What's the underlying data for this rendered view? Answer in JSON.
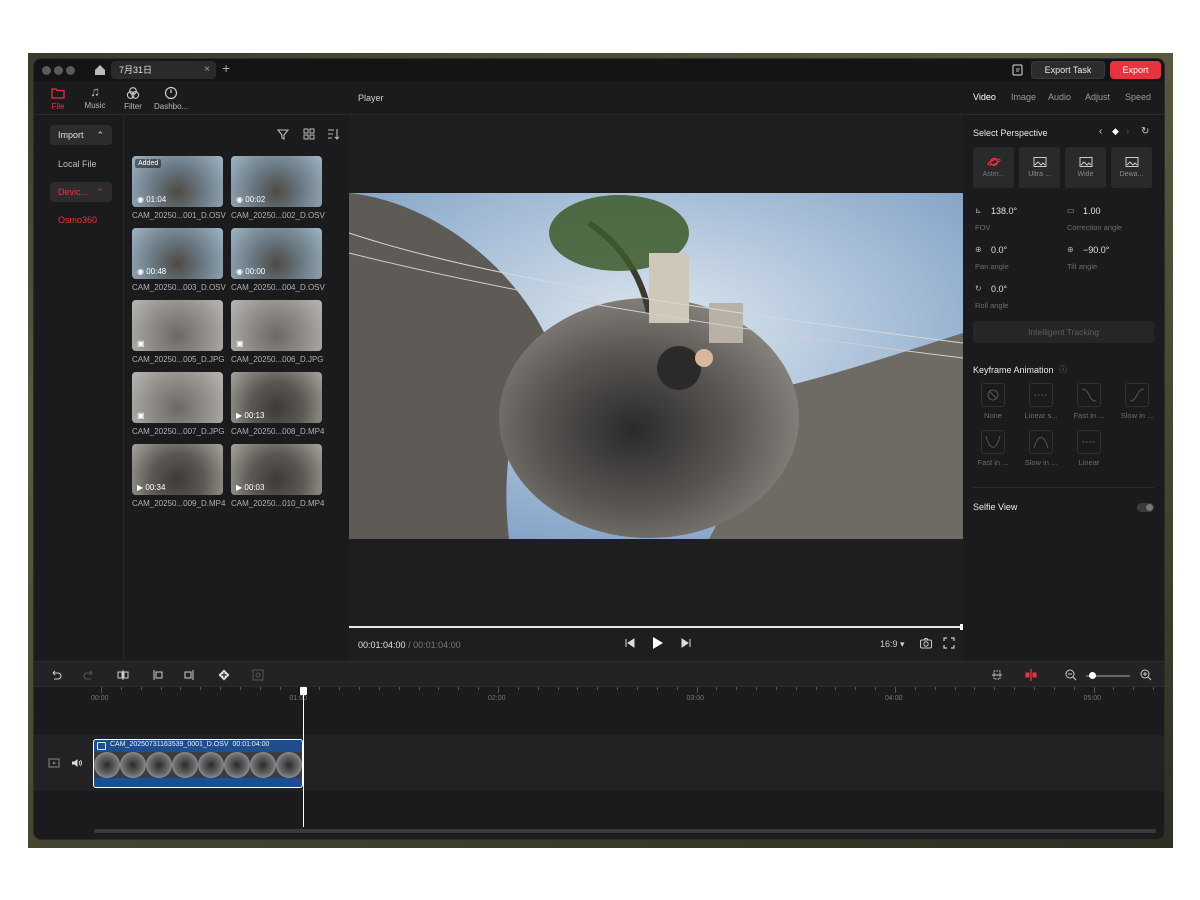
{
  "window": {
    "tab_title": "7月31日",
    "export_task_label": "Export Task",
    "export_label": "Export"
  },
  "topnav": [
    {
      "label": "File",
      "icon": "folder-icon",
      "active": true
    },
    {
      "label": "Music",
      "icon": "music-note-icon",
      "active": false
    },
    {
      "label": "Filter",
      "icon": "filter-circles-icon",
      "active": false
    },
    {
      "label": "Dashbo...",
      "icon": "gauge-icon",
      "active": false
    }
  ],
  "sidebar": {
    "import_label": "Import",
    "local_file_label": "Local File",
    "device_label": "Devic...",
    "osmo_label": "Osmo360"
  },
  "media": [
    {
      "name": "CAM_20250...001_D.OSV",
      "duration": "01:04",
      "badge": "Added",
      "kind": "osv"
    },
    {
      "name": "CAM_20250...002_D.OSV",
      "duration": "00:02",
      "badge": "",
      "kind": "osv"
    },
    {
      "name": "CAM_20250...003_D.OSV",
      "duration": "00:48",
      "badge": "",
      "kind": "osv"
    },
    {
      "name": "CAM_20250...004_D.OSV",
      "duration": "00:00",
      "badge": "",
      "kind": "osv"
    },
    {
      "name": "CAM_20250...005_D.JPG",
      "duration": "",
      "badge": "",
      "kind": "jpg"
    },
    {
      "name": "CAM_20250...006_D.JPG",
      "duration": "",
      "badge": "",
      "kind": "jpg"
    },
    {
      "name": "CAM_20250...007_D.JPG",
      "duration": "",
      "badge": "",
      "kind": "jpg"
    },
    {
      "name": "CAM_20250...008_D.MP4",
      "duration": "00:13",
      "badge": "",
      "kind": "mp4"
    },
    {
      "name": "CAM_20250...009_D.MP4",
      "duration": "00:34",
      "badge": "",
      "kind": "mp4"
    },
    {
      "name": "CAM_20250...010_D.MP4",
      "duration": "00:03",
      "badge": "",
      "kind": "mp4"
    }
  ],
  "player": {
    "title": "Player",
    "current_time": "00:01:04:00",
    "total_time": "/ 00:01:04:00",
    "aspect_ratio": "16:9 ▾"
  },
  "right_tabs": [
    {
      "label": "Video",
      "active": true
    },
    {
      "label": "Image",
      "active": false
    },
    {
      "label": "Audio",
      "active": false
    },
    {
      "label": "Adjust",
      "active": false
    },
    {
      "label": "Speed",
      "active": false
    }
  ],
  "perspective": {
    "title": "Select Perspective",
    "options": [
      {
        "label": "Aster...",
        "icon": "planet-icon",
        "active": true
      },
      {
        "label": "Ultra ...",
        "icon": "image-icon",
        "active": false
      },
      {
        "label": "Wide",
        "icon": "image-icon",
        "active": false
      },
      {
        "label": "Dewa...",
        "icon": "image-icon",
        "active": false
      }
    ]
  },
  "params": {
    "fov_value": "138.0°",
    "fov_label": "FOV",
    "correction_value": "1.00",
    "correction_label": "Correction angle",
    "pan_value": "0.0°",
    "pan_label": "Pan angle",
    "tilt_value": "−90.0°",
    "tilt_label": "Tilt angle",
    "roll_value": "0.0°",
    "roll_label": "Roll angle"
  },
  "tracking_label": "Intelligent Tracking",
  "keyframe": {
    "title": "Keyframe Animation",
    "options": [
      "None",
      "Linear s...",
      "Fast in ...",
      "Slow in ...",
      "Fast in ...",
      "Slow in ...",
      "Linear"
    ]
  },
  "selfie_label": "Selfie View",
  "timeline": {
    "ruler_labels": [
      "00:00",
      "01:00",
      "02:00",
      "03:00",
      "04:00",
      "05:00"
    ],
    "clip_name": "CAM_20250731163539_0001_D.OSV",
    "clip_duration": "00:01:04:00"
  },
  "colors": {
    "accent": "#e5343f",
    "clip_blue": "#1f4e8f",
    "bg": "#1b1b1d"
  }
}
